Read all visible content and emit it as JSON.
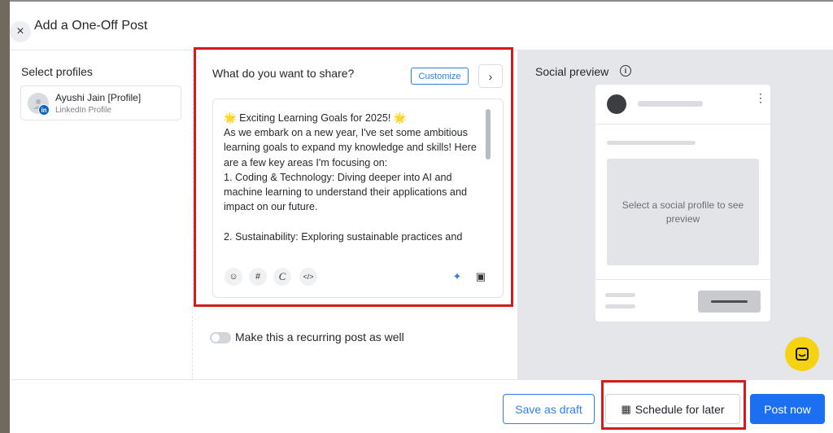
{
  "modal": {
    "title": "Add a One-Off Post",
    "close_icon": "×"
  },
  "profiles": {
    "heading": "Select profiles",
    "items": [
      {
        "name": "Ayushi Jain [Profile]",
        "type": "LinkedIn Profile",
        "badge": "in"
      }
    ]
  },
  "compose": {
    "heading": "What do you want to share?",
    "customize_label": "Customize",
    "next_icon": "›",
    "text": "🌟 Exciting Learning Goals for 2025! 🌟\nAs we embark on a new year, I've set some ambitious learning goals to expand my knowledge and skills! Here are a few key areas I'm focusing on:\n1. Coding & Technology: Diving deeper into AI and machine learning to understand their applications and impact on our future.\n\n2. Sustainability: Exploring sustainable practices and",
    "tools": {
      "emoji": "☺",
      "hashtag": "#",
      "canva": "C",
      "code": "</>",
      "ai": "✦",
      "media": "▣"
    }
  },
  "recurring": {
    "label": "Make this a recurring post as well",
    "enabled": false
  },
  "preview": {
    "heading": "Social preview",
    "info_icon": "i",
    "placeholder": "Select a social profile to see preview",
    "dots": "⋮"
  },
  "footer": {
    "save_draft": "Save as draft",
    "schedule_icon": "▦",
    "schedule": "Schedule for later",
    "post_now": "Post now"
  },
  "colors": {
    "primary": "#1d6ff2",
    "highlight": "#d21c1c",
    "chat": "#f5d312",
    "linkedin": "#0a66c2"
  }
}
